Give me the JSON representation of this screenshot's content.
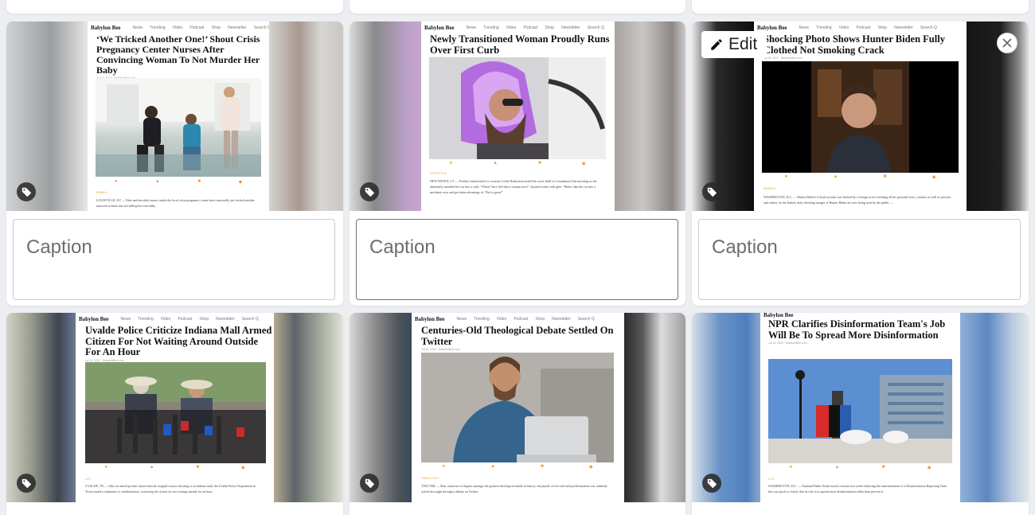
{
  "top_row": {},
  "post_site": {
    "logo": "Babylon Bee",
    "nav": [
      "News",
      "Trending",
      "Video",
      "Podcast",
      "Shop",
      "Newsletter",
      "Search Q"
    ]
  },
  "controls": {
    "edit_label": "Edit",
    "caption_placeholder": "Caption"
  },
  "cards": [
    {
      "headline": "‘We Tricked Another One!’ Shout Crisis Pregnancy Center Nurses After Convincing Woman To Not Murder Her Baby",
      "date": "Jul 13, 2022 · BabylonBee.com",
      "category": "FAMILY",
      "body": "LOUISVILLE, KY — Fake and deceitful nurses inside the local crisis pregnancy center have reportedly just tricked another innocent woman into not killing her own baby."
    },
    {
      "headline": "Newly Transitioned Woman Proudly Runs Over First Curb",
      "date": "Jul 18, 2022 · BabylonBee.com",
      "category": "LIFESTYLE",
      "body": "NEW HAVEN, CT — Freshly transitioned to a woman, Leslie Robertson tasted the sweet thrill of womanhood this morning as she absolutely smashed her car into a curb. “Whoo! Sure feel like a woman now!” shouted Leslie with glee. “Better take the car into a mechanic now and get taken advantage of. This is great!”"
    },
    {
      "headline": "Shocking Photo Shows Hunter Biden Fully Clothed Not Smoking Crack",
      "date": "Jul 18, 2022 · BabylonBee.com",
      "category": "WORLD",
      "body": "WASHINGTON, D.C. — Hunter Biden's iCloud account was hacked by a foreign actor revealing all his personal texts, contacts as well as pictures and videos. In the leaked, truly shocking images of Hunter Biden are now being seen by the public —"
    },
    {
      "headline": "Uvalde Police Criticize Indiana Mall Armed Citizen For Not Waiting Around Outside For An Hour",
      "date": "Jul 19, 2022 · BabylonBee.com",
      "category": "U.S.",
      "body": "UVALDE, TX — After an armed private citizen bravely stopped a mass shooting at an Indiana mall, the Uvalde Police Department in Texas issued a statement of condemnation, criticizing the citizen for not waiting outside for an hour."
    },
    {
      "headline": "Centuries-Old Theological Debate Settled On Twitter",
      "date": "Jul 30, 2022 · BabylonBee.com",
      "category": "THEOLOGY",
      "body": "TWITTER — After centuries of dispute amongst the greatest theological minds in history, the puzzle of free will and predestination was suddenly solved last night through a debate on Twitter."
    },
    {
      "headline": "NPR Clarifies Disinformation Team's Job Will Be To Spread More Disinformation",
      "date": "Jul 24, 2022 · BabylonBee.com",
      "category": "U.S.",
      "body": "WASHINGTON, D.C. — National Public Radio faced criticism last week following the announcement of a Disinformation Reporting Team but was quick to clarify that its role is to spread more disinformation rather than prevent it."
    }
  ]
}
